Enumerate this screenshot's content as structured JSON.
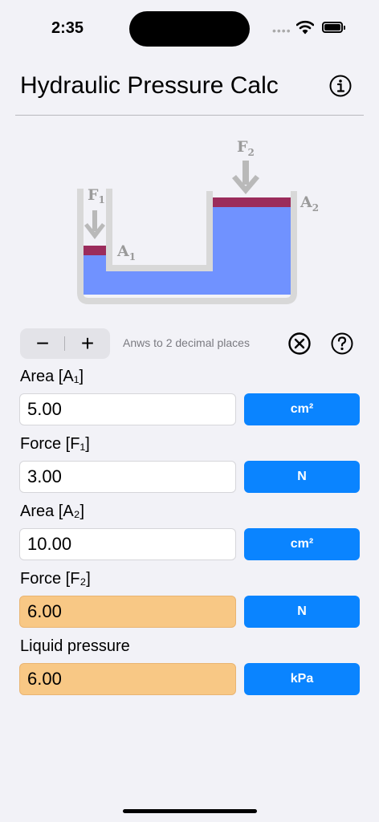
{
  "status": {
    "time": "2:35"
  },
  "header": {
    "title": "Hydraulic Pressure Calc"
  },
  "diagram": {
    "f1": "F",
    "f1_sub": "1",
    "f2": "F",
    "f2_sub": "2",
    "a1": "A",
    "a1_sub": "1",
    "a2": "A",
    "a2_sub": "2"
  },
  "controls": {
    "minus": "−",
    "plus": "+",
    "hint": "Anws to 2 decimal places"
  },
  "fields": [
    {
      "label": "Area [A₁]",
      "value": "5.00",
      "unit": "cm²"
    },
    {
      "label": "Force [F₁]",
      "value": "3.00",
      "unit": "N"
    },
    {
      "label": "Area [A₂]",
      "value": "10.00",
      "unit": "cm²"
    },
    {
      "label": "Force [F₂]",
      "value": "6.00",
      "unit": "N"
    },
    {
      "label": "Liquid pressure",
      "value": "6.00",
      "unit": "kPa"
    }
  ],
  "colors": {
    "accent": "#0a84ff",
    "result": "#f8c885",
    "liquid": "#7092ff",
    "piston": "#9b2c5c"
  }
}
